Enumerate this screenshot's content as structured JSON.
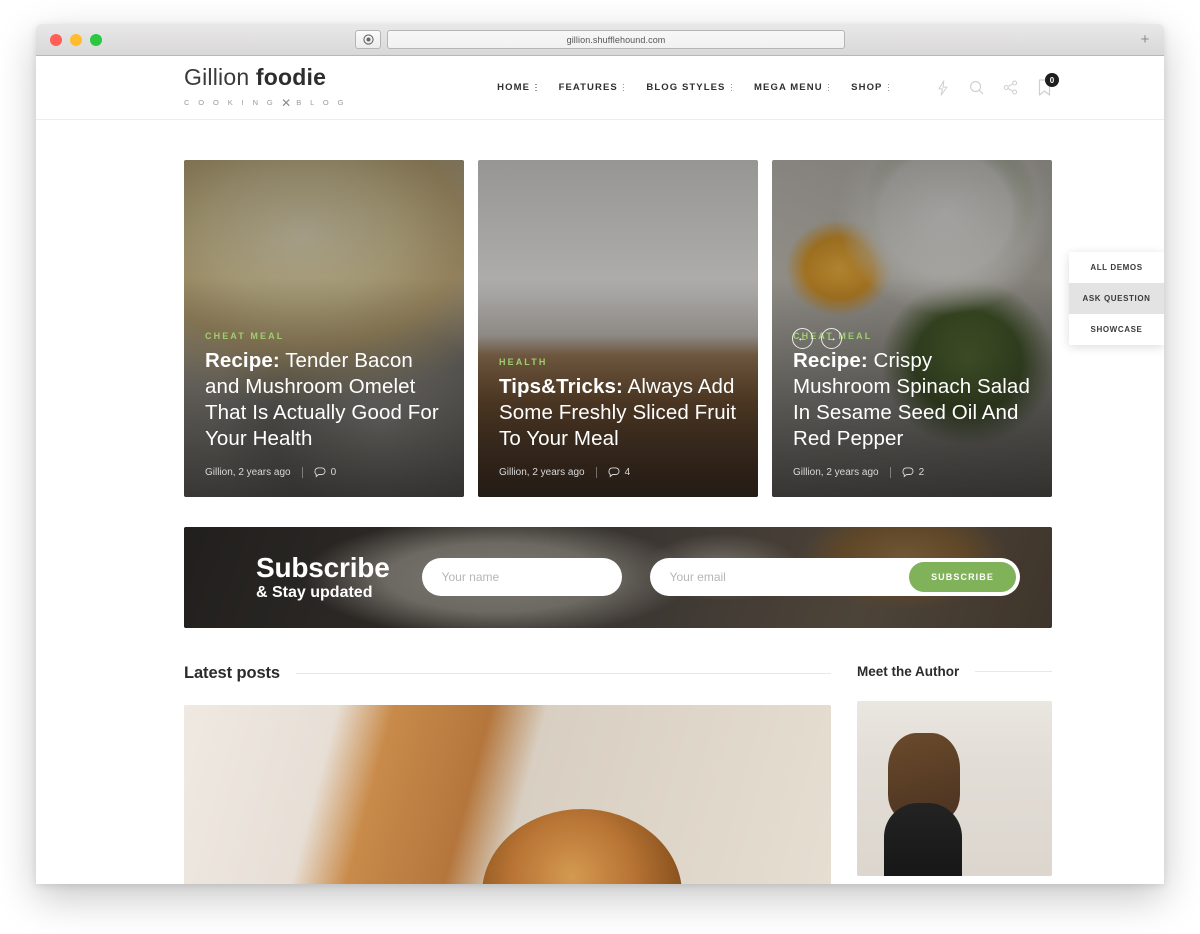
{
  "browser": {
    "url": "gillion.shufflehound.com",
    "new_tab_label": "+",
    "traffic_lights": [
      "close",
      "minimize",
      "maximize"
    ]
  },
  "header": {
    "logo_first": "Gillion",
    "logo_second": "foodie",
    "tagline_left": "C O O K I N G",
    "tagline_mark": "✕",
    "tagline_right": "B L O G",
    "nav": [
      {
        "label": "HOME"
      },
      {
        "label": "FEATURES"
      },
      {
        "label": "BLOG STYLES"
      },
      {
        "label": "MEGA MENU"
      },
      {
        "label": "SHOP"
      }
    ],
    "icons": [
      {
        "name": "lightning-icon"
      },
      {
        "name": "search-icon"
      },
      {
        "name": "share-icon"
      },
      {
        "name": "bookmark-icon",
        "badge": "0"
      }
    ]
  },
  "hero": {
    "cards": [
      {
        "category": "CHEAT MEAL",
        "title_lead": "Recipe:",
        "title_rest": " Tender Bacon and Mushroom Omelet That Is Actually Good For Your Health",
        "author": "Gillion, 2 years ago",
        "comments": "0"
      },
      {
        "category": "HEALTH",
        "title_lead": "Tips&Tricks:",
        "title_rest": " Always Add Some Freshly Sliced Fruit To Your Meal",
        "author": "Gillion, 2 years ago",
        "comments": "4"
      },
      {
        "category": "CHEAT MEAL",
        "title_lead": "Recipe:",
        "title_rest": " Crispy Mushroom Spinach Salad In Sesame Seed Oil And Red Pepper",
        "author": "Gillion, 2 years ago",
        "comments": "2",
        "prev_arrow": "←",
        "next_arrow": "→"
      }
    ]
  },
  "subscribe": {
    "title": "Subscribe",
    "subtitle": "& Stay updated",
    "name_placeholder": "Your name",
    "email_placeholder": "Your email",
    "button_label": "SUBSCRIBE",
    "button_color": "#7fb259"
  },
  "lower": {
    "latest_posts_title": "Latest posts",
    "author_title": "Meet the Author"
  },
  "side_panel": {
    "items": [
      {
        "label": "ALL DEMOS",
        "active": false
      },
      {
        "label": "ASK QUESTION",
        "active": true
      },
      {
        "label": "SHOWCASE",
        "active": false
      }
    ]
  },
  "colors": {
    "accent_green": "#9ecf6e",
    "button_green": "#7fb259",
    "text_dark": "#2b2b2b"
  }
}
